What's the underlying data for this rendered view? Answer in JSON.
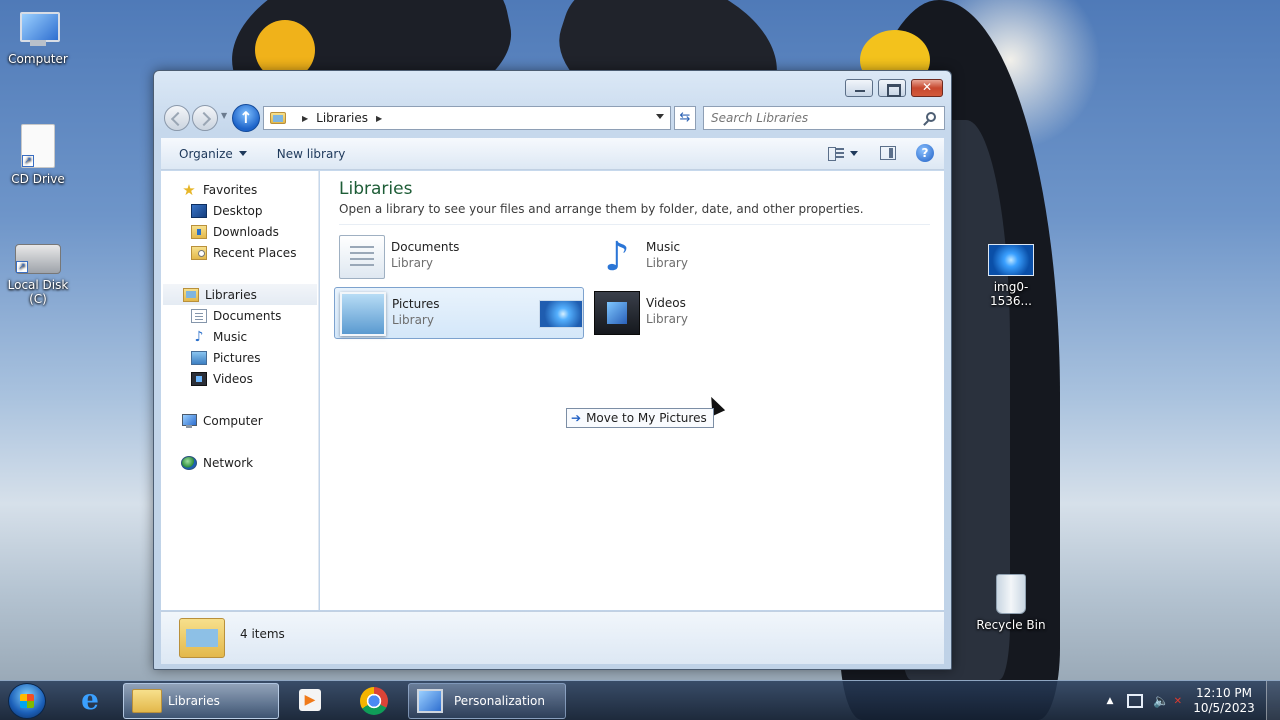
{
  "desktop": {
    "icons": [
      {
        "label": "Computer",
        "icon": "computer-icon"
      },
      {
        "label": "CD Drive",
        "icon": "cd-drive-icon"
      },
      {
        "label": "Local Disk (C)",
        "icon": "local-disk-icon"
      },
      {
        "label": "img0-1536...",
        "icon": "image-file-icon"
      },
      {
        "label": "Recycle Bin",
        "icon": "recycle-bin-icon"
      }
    ]
  },
  "window": {
    "title": "Libraries",
    "address": {
      "crumbs": [
        "Libraries"
      ]
    },
    "search": {
      "placeholder": "Search Libraries"
    },
    "toolbar": {
      "organize": "Organize",
      "new_library": "New library"
    },
    "nav": {
      "favorites": {
        "label": "Favorites",
        "items": [
          "Desktop",
          "Downloads",
          "Recent Places"
        ]
      },
      "libraries": {
        "label": "Libraries",
        "items": [
          "Documents",
          "Music",
          "Pictures",
          "Videos"
        ]
      },
      "computer": "Computer",
      "network": "Network"
    },
    "content": {
      "heading": "Libraries",
      "description": "Open a library to see your files and arrange them by folder, date, and other properties.",
      "items": [
        {
          "name": "Documents",
          "type": "Library",
          "icon": "documents-library-icon"
        },
        {
          "name": "Music",
          "type": "Library",
          "icon": "music-library-icon"
        },
        {
          "name": "Pictures",
          "type": "Library",
          "icon": "pictures-library-icon"
        },
        {
          "name": "Videos",
          "type": "Library",
          "icon": "videos-library-icon"
        }
      ]
    },
    "drag_tooltip": "Move to My Pictures",
    "status": {
      "count": "4 items"
    }
  },
  "taskbar": {
    "buttons": [
      {
        "label": "Libraries"
      },
      {
        "label": "Personalization"
      }
    ],
    "clock": {
      "time": "12:10 PM",
      "date": "10/5/2023"
    }
  },
  "colors": {
    "heading_green": "#1e5d37",
    "accent_blue": "#1f5fc4"
  }
}
